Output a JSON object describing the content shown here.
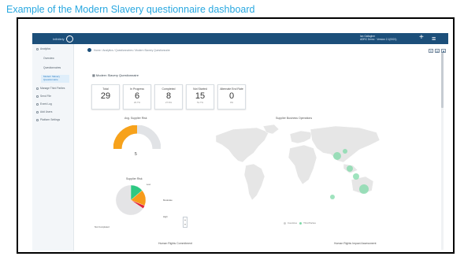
{
  "caption": "Example of the Modern Slavery questionnaire dashboard",
  "topbar": {
    "logo_text": "Infinitely",
    "user_name": "Ian Gallagher",
    "user_org": "ADRC Demo · Version 2.1(0021)",
    "plus_label": "+",
    "menu_label": "≡"
  },
  "sidebar": {
    "items": [
      {
        "label": "Analytics",
        "icon": "chart-icon"
      },
      {
        "label": "Overview",
        "icon": ""
      },
      {
        "label": "Questionnaires",
        "icon": ""
      },
      {
        "label": "Manage Third Parties",
        "icon": "users-icon"
      },
      {
        "label": "Send File",
        "icon": "send-icon"
      },
      {
        "label": "Event Log",
        "icon": "log-icon"
      },
      {
        "label": "Add Users",
        "icon": "user-add-icon"
      },
      {
        "label": "Platform Settings",
        "icon": "gear-icon"
      }
    ],
    "active_sub": "Modern Slavery Questionnaire"
  },
  "breadcrumb": "Home  /  Analytics  /  Questionnaires  /  Modern Slavery Questionnaire",
  "toolbar": [
    "▼",
    "▥",
    "◉"
  ],
  "questionnaire_title": "Modern Slavery Questionnaire",
  "cards": [
    {
      "label": "Total",
      "value": "29",
      "pct": ""
    },
    {
      "label": "In Progress",
      "value": "6",
      "pct": "20.7%"
    },
    {
      "label": "Completed",
      "value": "8",
      "pct": "27.6%"
    },
    {
      "label": "Not Started",
      "value": "15",
      "pct": "51.7%"
    },
    {
      "label": "Alternate End Rate",
      "value": "0",
      "pct": "0%"
    }
  ],
  "gauge": {
    "title": "Avg. Supplier Risk",
    "value": "5",
    "fill": 0.5,
    "color": "#f7a21b"
  },
  "pie": {
    "title": "Supplier Risk",
    "slices": [
      {
        "label": "Low",
        "value": 4,
        "color": "#2ec882"
      },
      {
        "label": "Moderate",
        "value": 5,
        "color": "#f79b1b"
      },
      {
        "label": "High",
        "value": 1,
        "color": "#e0263a"
      },
      {
        "label": "Not Completed",
        "value": 19,
        "color": "#e4e4e6"
      }
    ],
    "pager_label": "▲ ▼"
  },
  "map": {
    "title": "Supplier Business Operations",
    "legend": [
      "Countries",
      "Third Parties"
    ],
    "colors": {
      "land": "#e6e6e6",
      "bubble": "#7fd9a8"
    }
  },
  "bottom": {
    "left_title": "Human Rights Commitment",
    "right_title": "Human Rights Impact Assessment"
  }
}
